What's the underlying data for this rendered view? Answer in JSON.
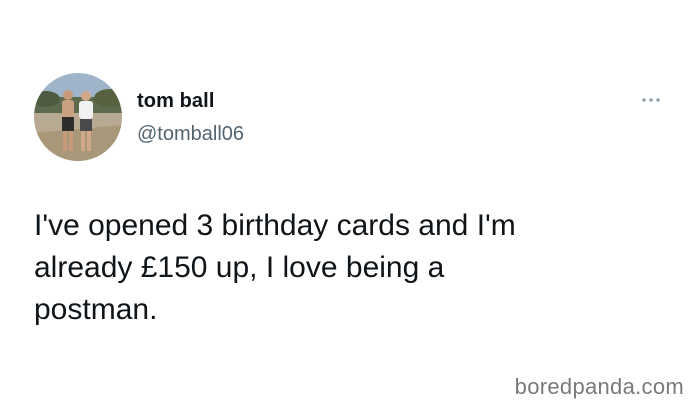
{
  "tweet": {
    "author_name": "tom ball",
    "author_handle": "@tomball06",
    "text": "I've opened 3 birthday cards and I'm\nalready £150 up, I love being a\npostman.",
    "more_icon": "more-options-icon",
    "avatar_icon": "profile-photo"
  },
  "watermark": "boredpanda.com",
  "colors": {
    "text": "#0f1419",
    "secondary": "#536471",
    "watermark": "#7a7a7a"
  }
}
